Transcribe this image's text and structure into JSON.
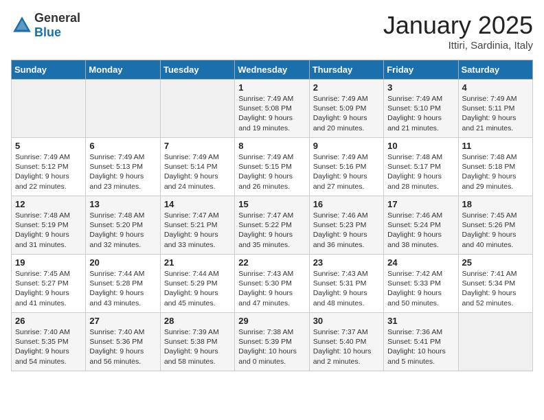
{
  "header": {
    "logo_general": "General",
    "logo_blue": "Blue",
    "month_title": "January 2025",
    "location": "Ittiri, Sardinia, Italy"
  },
  "days_of_week": [
    "Sunday",
    "Monday",
    "Tuesday",
    "Wednesday",
    "Thursday",
    "Friday",
    "Saturday"
  ],
  "weeks": [
    [
      {
        "day": "",
        "content": ""
      },
      {
        "day": "",
        "content": ""
      },
      {
        "day": "",
        "content": ""
      },
      {
        "day": "1",
        "content": "Sunrise: 7:49 AM\nSunset: 5:08 PM\nDaylight: 9 hours\nand 19 minutes."
      },
      {
        "day": "2",
        "content": "Sunrise: 7:49 AM\nSunset: 5:09 PM\nDaylight: 9 hours\nand 20 minutes."
      },
      {
        "day": "3",
        "content": "Sunrise: 7:49 AM\nSunset: 5:10 PM\nDaylight: 9 hours\nand 21 minutes."
      },
      {
        "day": "4",
        "content": "Sunrise: 7:49 AM\nSunset: 5:11 PM\nDaylight: 9 hours\nand 21 minutes."
      }
    ],
    [
      {
        "day": "5",
        "content": "Sunrise: 7:49 AM\nSunset: 5:12 PM\nDaylight: 9 hours\nand 22 minutes."
      },
      {
        "day": "6",
        "content": "Sunrise: 7:49 AM\nSunset: 5:13 PM\nDaylight: 9 hours\nand 23 minutes."
      },
      {
        "day": "7",
        "content": "Sunrise: 7:49 AM\nSunset: 5:14 PM\nDaylight: 9 hours\nand 24 minutes."
      },
      {
        "day": "8",
        "content": "Sunrise: 7:49 AM\nSunset: 5:15 PM\nDaylight: 9 hours\nand 26 minutes."
      },
      {
        "day": "9",
        "content": "Sunrise: 7:49 AM\nSunset: 5:16 PM\nDaylight: 9 hours\nand 27 minutes."
      },
      {
        "day": "10",
        "content": "Sunrise: 7:48 AM\nSunset: 5:17 PM\nDaylight: 9 hours\nand 28 minutes."
      },
      {
        "day": "11",
        "content": "Sunrise: 7:48 AM\nSunset: 5:18 PM\nDaylight: 9 hours\nand 29 minutes."
      }
    ],
    [
      {
        "day": "12",
        "content": "Sunrise: 7:48 AM\nSunset: 5:19 PM\nDaylight: 9 hours\nand 31 minutes."
      },
      {
        "day": "13",
        "content": "Sunrise: 7:48 AM\nSunset: 5:20 PM\nDaylight: 9 hours\nand 32 minutes."
      },
      {
        "day": "14",
        "content": "Sunrise: 7:47 AM\nSunset: 5:21 PM\nDaylight: 9 hours\nand 33 minutes."
      },
      {
        "day": "15",
        "content": "Sunrise: 7:47 AM\nSunset: 5:22 PM\nDaylight: 9 hours\nand 35 minutes."
      },
      {
        "day": "16",
        "content": "Sunrise: 7:46 AM\nSunset: 5:23 PM\nDaylight: 9 hours\nand 36 minutes."
      },
      {
        "day": "17",
        "content": "Sunrise: 7:46 AM\nSunset: 5:24 PM\nDaylight: 9 hours\nand 38 minutes."
      },
      {
        "day": "18",
        "content": "Sunrise: 7:45 AM\nSunset: 5:26 PM\nDaylight: 9 hours\nand 40 minutes."
      }
    ],
    [
      {
        "day": "19",
        "content": "Sunrise: 7:45 AM\nSunset: 5:27 PM\nDaylight: 9 hours\nand 41 minutes."
      },
      {
        "day": "20",
        "content": "Sunrise: 7:44 AM\nSunset: 5:28 PM\nDaylight: 9 hours\nand 43 minutes."
      },
      {
        "day": "21",
        "content": "Sunrise: 7:44 AM\nSunset: 5:29 PM\nDaylight: 9 hours\nand 45 minutes."
      },
      {
        "day": "22",
        "content": "Sunrise: 7:43 AM\nSunset: 5:30 PM\nDaylight: 9 hours\nand 47 minutes."
      },
      {
        "day": "23",
        "content": "Sunrise: 7:43 AM\nSunset: 5:31 PM\nDaylight: 9 hours\nand 48 minutes."
      },
      {
        "day": "24",
        "content": "Sunrise: 7:42 AM\nSunset: 5:33 PM\nDaylight: 9 hours\nand 50 minutes."
      },
      {
        "day": "25",
        "content": "Sunrise: 7:41 AM\nSunset: 5:34 PM\nDaylight: 9 hours\nand 52 minutes."
      }
    ],
    [
      {
        "day": "26",
        "content": "Sunrise: 7:40 AM\nSunset: 5:35 PM\nDaylight: 9 hours\nand 54 minutes."
      },
      {
        "day": "27",
        "content": "Sunrise: 7:40 AM\nSunset: 5:36 PM\nDaylight: 9 hours\nand 56 minutes."
      },
      {
        "day": "28",
        "content": "Sunrise: 7:39 AM\nSunset: 5:38 PM\nDaylight: 9 hours\nand 58 minutes."
      },
      {
        "day": "29",
        "content": "Sunrise: 7:38 AM\nSunset: 5:39 PM\nDaylight: 10 hours\nand 0 minutes."
      },
      {
        "day": "30",
        "content": "Sunrise: 7:37 AM\nSunset: 5:40 PM\nDaylight: 10 hours\nand 2 minutes."
      },
      {
        "day": "31",
        "content": "Sunrise: 7:36 AM\nSunset: 5:41 PM\nDaylight: 10 hours\nand 5 minutes."
      },
      {
        "day": "",
        "content": ""
      }
    ]
  ]
}
